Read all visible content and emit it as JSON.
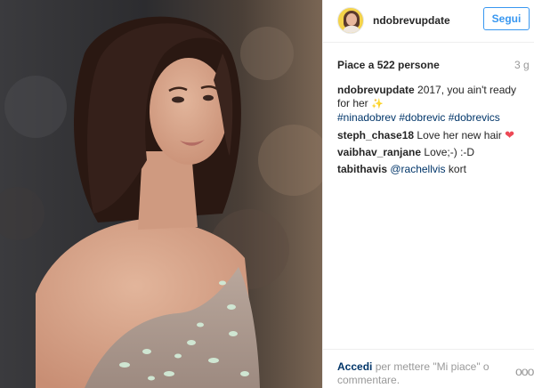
{
  "post": {
    "username": "ndobrevupdate",
    "follow_label": "Segui",
    "likes": "Piace a 522 persone",
    "time": "3 g"
  },
  "comments": [
    {
      "author": "ndobrevupdate",
      "text": "2017, you ain't ready for her",
      "sparkle": "✨",
      "tags": "#ninadobrev #dobrevic #dobrevics"
    },
    {
      "author": "steph_chase18",
      "text": "Love her new hair",
      "heart": "❤"
    },
    {
      "author": "vaibhav_ranjane",
      "text": "Love;-) :-D"
    },
    {
      "author": "tabithavis",
      "mention": "@rachellvis",
      "text": "kort"
    }
  ],
  "footer": {
    "login_label": "Accedi",
    "login_rest": "per mettere \"Mi piace\" o commentare.",
    "more_label": "ooo"
  },
  "colors": {
    "link": "#003569",
    "follow": "#3897f0",
    "heart": "#ed4956",
    "muted": "#999999"
  },
  "icons": [
    "sparkle-icon",
    "heart-icon",
    "more-options-icon"
  ]
}
